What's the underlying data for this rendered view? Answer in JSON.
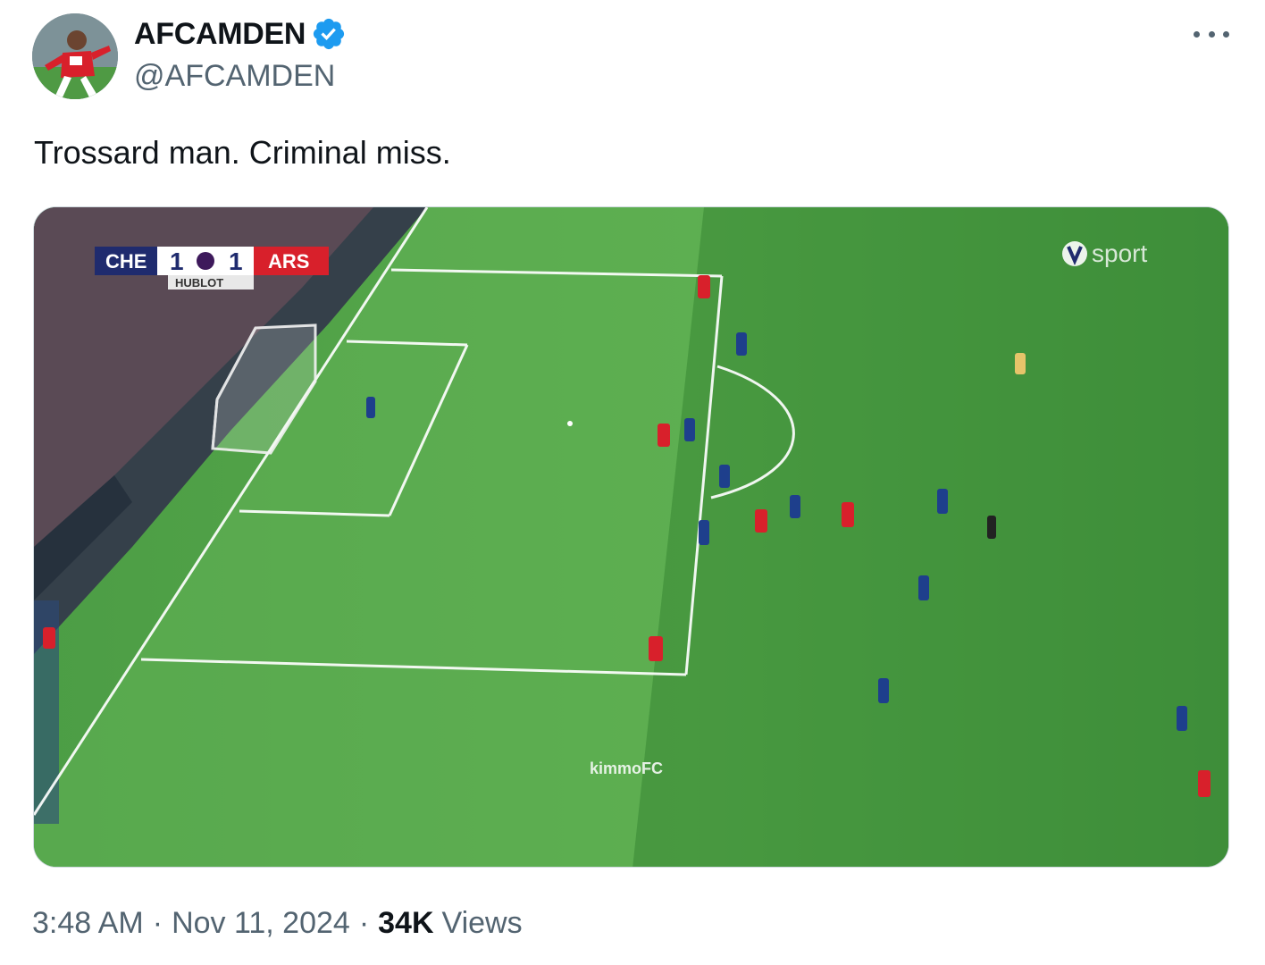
{
  "author": {
    "display_name": "AFCAMDEN",
    "handle": "@AFCAMDEN",
    "verified": true,
    "avatar_icon": "avatar-icon"
  },
  "tweet": {
    "text": "Trossard man. Criminal miss."
  },
  "media": {
    "scoreboard": {
      "home_team": "CHE",
      "home_score": "1",
      "away_score": "1",
      "away_team": "ARS",
      "sponsor": "HUBLOT"
    },
    "broadcaster": "sport",
    "watermark": "kimmoFC"
  },
  "meta": {
    "time": "3:48 AM",
    "date": "Nov 11, 2024",
    "views_count": "34K",
    "views_label": "Views"
  },
  "colors": {
    "accent": "#1d9bf0",
    "secondary_text": "#536471",
    "pitch_light": "#52a447",
    "pitch_dark": "#3f8f3b",
    "arsenal_red": "#d8202b",
    "chelsea_blue": "#1e3f8c"
  }
}
